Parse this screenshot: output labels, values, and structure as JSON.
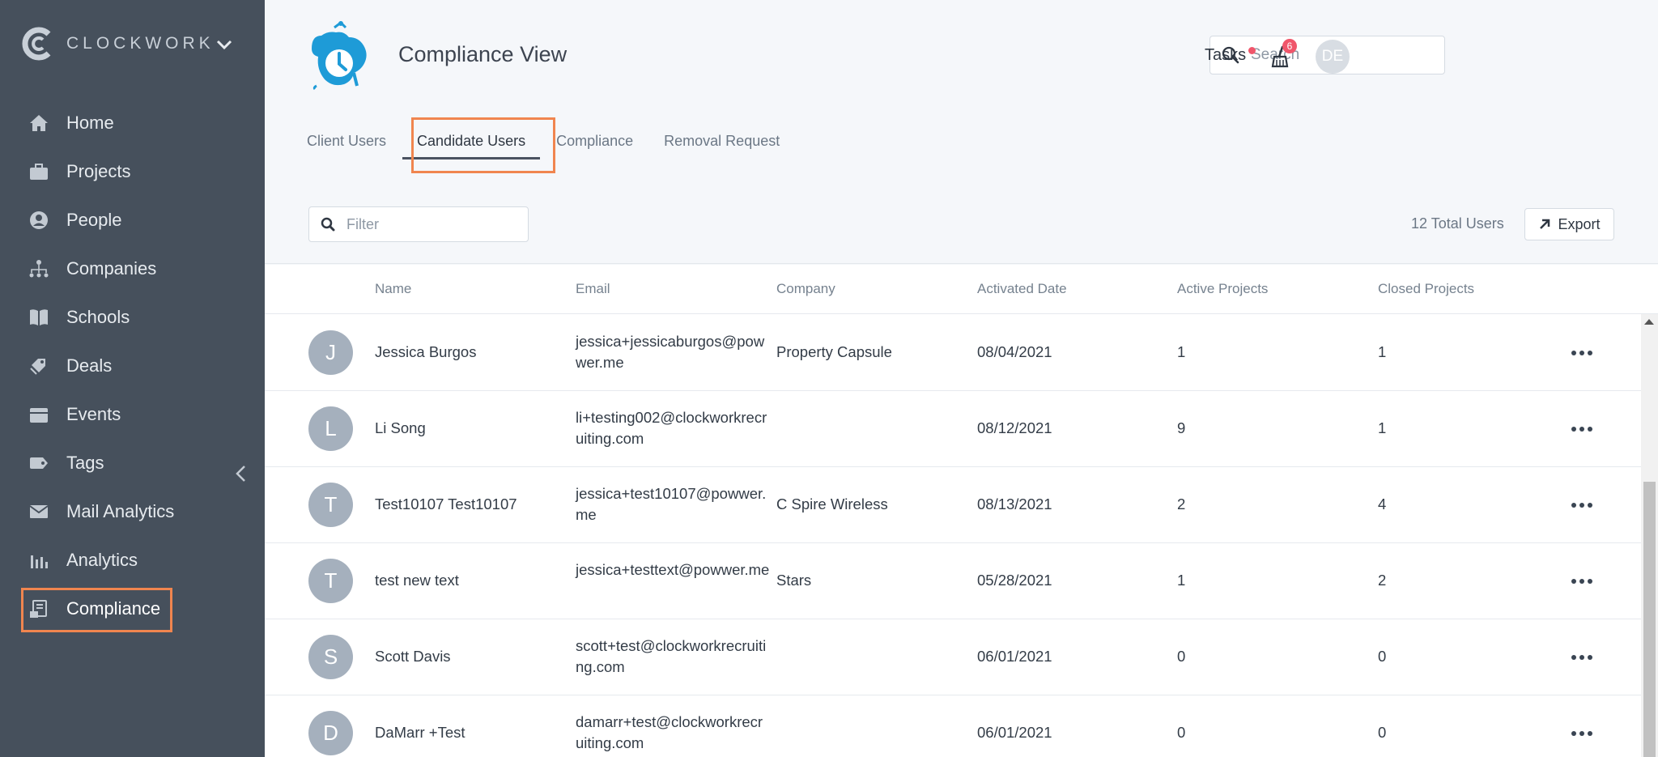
{
  "sidebar": {
    "brand": "CLOCKWORK",
    "items": [
      {
        "label": "Home",
        "icon": "home-icon"
      },
      {
        "label": "Projects",
        "icon": "briefcase-icon"
      },
      {
        "label": "People",
        "icon": "person-icon"
      },
      {
        "label": "Companies",
        "icon": "org-chart-icon"
      },
      {
        "label": "Schools",
        "icon": "book-icon"
      },
      {
        "label": "Deals",
        "icon": "tags-icon"
      },
      {
        "label": "Events",
        "icon": "calendar-icon"
      },
      {
        "label": "Tags",
        "icon": "tag-icon"
      },
      {
        "label": "Mail Analytics",
        "icon": "mail-icon"
      },
      {
        "label": "Analytics",
        "icon": "bar-chart-icon"
      },
      {
        "label": "Compliance",
        "icon": "compliance-icon"
      }
    ],
    "active": "Compliance"
  },
  "header": {
    "title": "Compliance View",
    "search_placeholder": "Search",
    "tasks_label": "Tasks",
    "notification_count": "6",
    "user_initials": "DE"
  },
  "tabs": [
    {
      "label": "Client Users"
    },
    {
      "label": "Candidate Users"
    },
    {
      "label": "Compliance"
    },
    {
      "label": "Removal Request"
    }
  ],
  "active_tab": "Candidate Users",
  "toolbar": {
    "filter_placeholder": "Filter",
    "total_users": "12 Total Users",
    "export_label": "Export"
  },
  "table": {
    "columns": [
      "Name",
      "Email",
      "Company",
      "Activated Date",
      "Active Projects",
      "Closed Projects"
    ],
    "rows": [
      {
        "initial": "J",
        "name": "Jessica Burgos",
        "email": "jessica+jessicaburgos@powwer.me",
        "company": "Property Capsule",
        "activated": "08/04/2021",
        "active": "1",
        "closed": "1"
      },
      {
        "initial": "L",
        "name": "Li Song",
        "email": "li+testing002@clockworkrecruiting.com",
        "company": "",
        "activated": "08/12/2021",
        "active": "9",
        "closed": "1"
      },
      {
        "initial": "T",
        "name": "Test10107 Test10107",
        "email": "jessica+test10107@powwer.me",
        "company": "C Spire Wireless",
        "activated": "08/13/2021",
        "active": "2",
        "closed": "4"
      },
      {
        "initial": "T",
        "name": "test new text",
        "email": "jessica+testtext@powwer.me",
        "company": "Stars",
        "activated": "05/28/2021",
        "active": "1",
        "closed": "2"
      },
      {
        "initial": "S",
        "name": "Scott Davis",
        "email": "scott+test@clockworkrecruiting.com",
        "company": "",
        "activated": "06/01/2021",
        "active": "0",
        "closed": "0"
      },
      {
        "initial": "D",
        "name": "DaMarr +Test",
        "email": "damarr+test@clockworkrecruiting.com",
        "company": "",
        "activated": "06/01/2021",
        "active": "0",
        "closed": "0"
      }
    ]
  },
  "colors": {
    "sidebar_bg": "#46505c",
    "highlight": "#f0854f",
    "badge": "#f0566b"
  }
}
